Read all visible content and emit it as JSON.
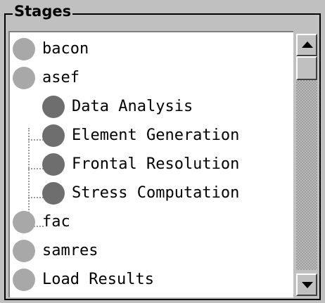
{
  "group": {
    "title": "Stages"
  },
  "stages": [
    {
      "label": "bacon",
      "level": 0,
      "status": "inactive"
    },
    {
      "label": "asef",
      "level": 0,
      "status": "inactive"
    },
    {
      "label": "Data Analysis",
      "level": 1,
      "status": "active"
    },
    {
      "label": "Element Generation",
      "level": 1,
      "status": "active"
    },
    {
      "label": "Frontal Resolution",
      "level": 1,
      "status": "active"
    },
    {
      "label": "Stress Computation",
      "level": 1,
      "status": "active"
    },
    {
      "label": "fac",
      "level": 0,
      "status": "inactive"
    },
    {
      "label": "samres",
      "level": 0,
      "status": "inactive"
    },
    {
      "label": "Load Results",
      "level": 0,
      "status": "inactive"
    }
  ],
  "colors": {
    "inactive_bullet": "#a8a8a8",
    "active_bullet": "#6e6e6e",
    "background": "#c0c0c0"
  },
  "scrollbar": {
    "up_icon": "arrow-up-icon",
    "down_icon": "arrow-down-icon"
  }
}
